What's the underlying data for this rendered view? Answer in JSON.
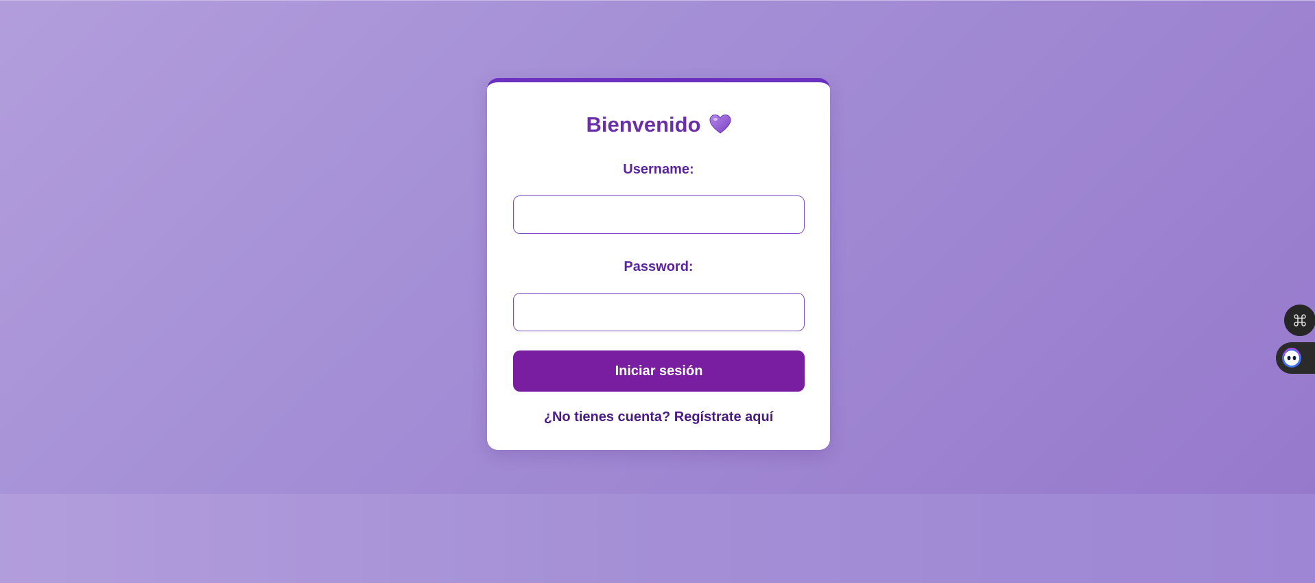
{
  "login_card": {
    "title": "Bienvenido",
    "title_icon": "purple-heart-icon",
    "username_label": "Username:",
    "username_value": "",
    "password_label": "Password:",
    "password_value": "",
    "submit_label": "Iniciar sesión",
    "register_link": "¿No tienes cuenta? Regístrate aquí"
  },
  "side_widgets": {
    "first_icon": "command-icon",
    "second_icon": "assistant-face-icon"
  },
  "colors": {
    "accent": "#7a1ea1",
    "title": "#6a2fa8",
    "card_border": "#6a2fbf",
    "background": "#a48fd6"
  }
}
